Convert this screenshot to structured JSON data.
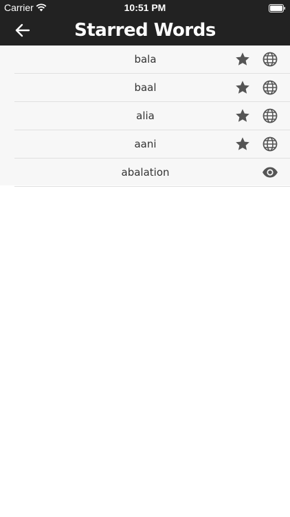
{
  "status_bar": {
    "carrier": "Carrier",
    "time": "10:51 PM"
  },
  "nav": {
    "title": "Starred Words",
    "back_icon": "arrow-left-icon"
  },
  "words": [
    {
      "label": "bala",
      "icons": [
        "star-icon",
        "globe-icon"
      ]
    },
    {
      "label": "baal",
      "icons": [
        "star-icon",
        "globe-icon"
      ]
    },
    {
      "label": "alia",
      "icons": [
        "star-icon",
        "globe-icon"
      ]
    },
    {
      "label": "aani",
      "icons": [
        "star-icon",
        "globe-icon"
      ]
    },
    {
      "label": "abalation",
      "icons": [
        "eye-icon"
      ]
    }
  ],
  "colors": {
    "bar_background": "#222222",
    "list_background": "#f7f7f7",
    "icon_color": "#555555",
    "text_color": "#333333"
  }
}
